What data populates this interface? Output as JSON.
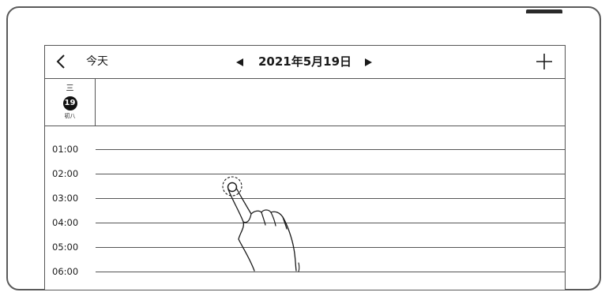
{
  "header": {
    "back_icon": "chevron-left-icon",
    "today_label": "今天",
    "prev_icon": "triangle-left-icon",
    "date_title": "2021年5月19日",
    "next_icon": "triangle-right-icon",
    "add_icon": "plus-icon"
  },
  "date_column": {
    "weekday": "三",
    "day": "19",
    "lunar": "初八"
  },
  "hours": [
    "01:00",
    "02:00",
    "03:00",
    "04:00",
    "05:00",
    "06:00"
  ],
  "gesture": {
    "icon": "tap-gesture-hand-icon"
  },
  "colors": {
    "ink": "#1a1a1a",
    "line": "#555555",
    "frame": "#5a5a5a"
  }
}
